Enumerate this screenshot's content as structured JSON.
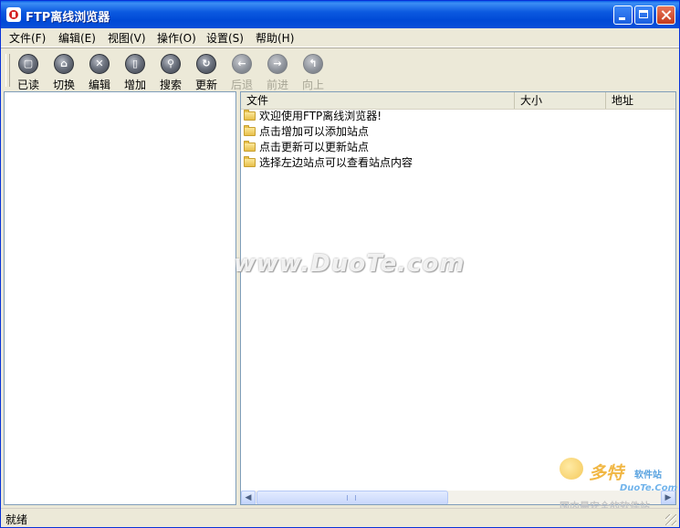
{
  "window": {
    "title": "FTP离线浏览器"
  },
  "menu": [
    "文件(F)",
    "编辑(E)",
    "视图(V)",
    "操作(O)",
    "设置(S)",
    "帮助(H)"
  ],
  "toolbar": [
    {
      "label": "已读",
      "icon": "read-icon",
      "enabled": true
    },
    {
      "label": "切换",
      "icon": "home-icon",
      "enabled": true
    },
    {
      "label": "编辑",
      "icon": "edit-icon",
      "enabled": true
    },
    {
      "label": "增加",
      "icon": "add-icon",
      "enabled": true
    },
    {
      "label": "搜索",
      "icon": "search-icon",
      "enabled": true
    },
    {
      "label": "更新",
      "icon": "refresh-icon",
      "enabled": true
    },
    {
      "label": "后退",
      "icon": "back-icon",
      "enabled": false
    },
    {
      "label": "前进",
      "icon": "forward-icon",
      "enabled": false
    },
    {
      "label": "向上",
      "icon": "up-icon",
      "enabled": false
    }
  ],
  "filelist": {
    "columns": [
      "文件",
      "大小",
      "地址"
    ],
    "rows": [
      "欢迎使用FTP离线浏览器!",
      "点击增加可以添加站点",
      "点击更新可以更新站点",
      "选择左边站点可以查看站点内容"
    ]
  },
  "watermark": {
    "text": "www.DuoTe.com",
    "brand": "多特",
    "brand_tag": "软件站",
    "brand_site": "DuoTe.Com",
    "slogan": "国内最安全的软件站"
  },
  "status": "就绪",
  "colors": {
    "titlebar": "#0a5fe8",
    "chrome": "#ece9d8",
    "pane_border": "#7f9db9"
  }
}
